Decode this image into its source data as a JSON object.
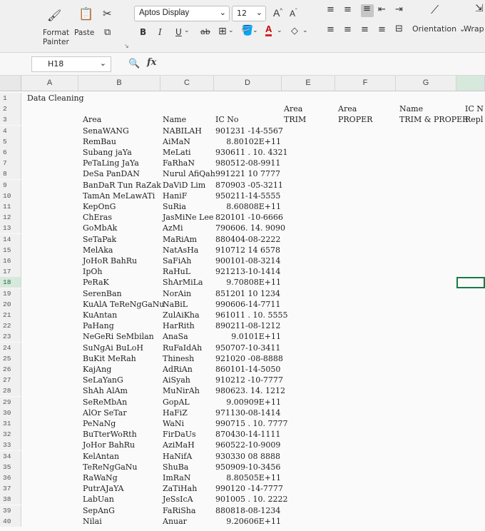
{
  "ribbon": {
    "format_painter": "Format\nPainter",
    "paste": "Paste",
    "font_name": "Aptos Display",
    "font_size": "12",
    "bold": "B",
    "italic": "I",
    "underline": "U",
    "strike": "ab",
    "grow": "A",
    "shrink": "A",
    "orientation": "Orientation",
    "wrap": "Wrap"
  },
  "formula_bar": {
    "name_box": "H18",
    "fx": "fx",
    "formula": ""
  },
  "columns": [
    "A",
    "B",
    "C",
    "D",
    "E",
    "F",
    "G"
  ],
  "rows": [
    {
      "n": "1",
      "a": "Data Cleaning"
    },
    {
      "n": "2",
      "e": "Area",
      "f": "Area",
      "g": "Name",
      "h": "IC N"
    },
    {
      "n": "3",
      "b": "Area",
      "c": "Name",
      "d": "IC No",
      "e": "TRIM",
      "f": "PROPER",
      "g": "TRIM & PROPER",
      "h": "Repl"
    },
    {
      "n": "4",
      "b": "SenaWANG",
      "c": "NABILAH",
      "d": "901231 -14-5567"
    },
    {
      "n": "5",
      "b": "RemBau",
      "c": "AiMaN",
      "dnum": "8.80102E+11"
    },
    {
      "n": "6",
      "b": "Subang jaYa",
      "c": "MeLati",
      "d": "930611 . 10. 4321"
    },
    {
      "n": "7",
      "b": "PeTaLing    JaYa",
      "c": "FaRhaN",
      "d": "980512-08-9911"
    },
    {
      "n": "8",
      "b": "DeSa PanDAN",
      "c": "Nurul AfiQah",
      "d": "991221 10 7777"
    },
    {
      "n": "9",
      "b": "BanDaR Tun RaZak",
      "c": "DaViD Lim",
      "d": "870903 -05-3211"
    },
    {
      "n": "10",
      "b": "TamAn  MeLawATi",
      "c": "HaniF",
      "d": "950211-14-5555"
    },
    {
      "n": "11",
      "b": "  KepOnG",
      "c": "SuRia",
      "dnum": "8.60808E+11"
    },
    {
      "n": "12",
      "b": "ChEras",
      "c": "JasMiNe Lee",
      "d": "820101 -10-6666"
    },
    {
      "n": "13",
      "b": "  GoMbAk",
      "c": "AzMi",
      "d": "790606. 14. 9090"
    },
    {
      "n": "14",
      "b": "SeTaPak",
      "c": "MaRiAm",
      "d": "880404-08-2222"
    },
    {
      "n": "15",
      "b": "MelAka",
      "c": "NatAsHa",
      "d": "910712 14 6578"
    },
    {
      "n": "16",
      "b": "JoHoR BahRu",
      "c": "SaFiAh",
      "d": "900101-08-3214"
    },
    {
      "n": "17",
      "b": "  IpOh",
      "c": "RaHuL",
      "d": "921213-10-1414"
    },
    {
      "n": "18",
      "b": "PeRaK",
      "c": "ShArMiLa",
      "dnum": "9.70808E+11"
    },
    {
      "n": "19",
      "b": "SerenBan",
      "c": "NorAin",
      "d": "851201 10 1234"
    },
    {
      "n": "20",
      "b": "KuAlA  TeReNgGaNu",
      "c": "NaBiL",
      "d": "990606-14-7711"
    },
    {
      "n": "21",
      "b": "KuAntan",
      "c": "ZulAiKha",
      "d": "961011 . 10. 5555"
    },
    {
      "n": "22",
      "b": "PaHang",
      "c": "HarRith",
      "d": "890211-08-1212"
    },
    {
      "n": "23",
      "b": "NeGeRi  SeMbilan",
      "c": "AnaSa",
      "dnum": "9.0101E+11"
    },
    {
      "n": "24",
      "b": "SuNgAi BuLoH",
      "c": "RuFaIdAh",
      "d": "950707-10-3411"
    },
    {
      "n": "25",
      "b": "BuKit MeRah",
      "c": "Thinesh",
      "d": "921020 -08-8888"
    },
    {
      "n": "26",
      "b": "KajAng",
      "c": "AdRiAn",
      "d": "860101-14-5050"
    },
    {
      "n": "27",
      "b": "SeLaYanG",
      "c": "AiSyah",
      "d": "910212 -10-7777"
    },
    {
      "n": "28",
      "b": "ShAh  AlAm",
      "c": "MuNirAh",
      "d": "980623. 14. 1212"
    },
    {
      "n": "29",
      "b": "SeReMbAn",
      "c": "GopAL",
      "dnum": "9.00909E+11"
    },
    {
      "n": "30",
      "b": "AlOr SeTar",
      "c": "HaFiZ",
      "d": "971130-08-1414"
    },
    {
      "n": "31",
      "b": "PeNaNg",
      "c": "WaNi",
      "d": "990715 . 10. 7777"
    },
    {
      "n": "32",
      "b": "BuTterWoRth",
      "c": "FirDaUs",
      "d": "870430-14-1111"
    },
    {
      "n": "33",
      "b": "JoHor BahRu",
      "c": "AziMaH",
      "d": "960522-10-9009"
    },
    {
      "n": "34",
      "b": "KelAntan",
      "c": "  HaNifA",
      "d": "930330 08 8888"
    },
    {
      "n": "35",
      "b": "TeReNgGaNu",
      "c": "ShuBa",
      "d": "950909-10-3456"
    },
    {
      "n": "36",
      "b": "RaWaNg",
      "c": "  ImRaN",
      "dnum": "8.80505E+11"
    },
    {
      "n": "37",
      "b": "PutrAJaYA",
      "c": "ZaTiHah",
      "d": "990120 -14-7777"
    },
    {
      "n": "38",
      "b": "LabUan",
      "c": "JeSsIcA",
      "d": "901005 . 10. 2222"
    },
    {
      "n": "39",
      "b": "SepAnG",
      "c": "FaRiSha",
      "d": "880818-08-1234"
    },
    {
      "n": "40",
      "b": "Nilai",
      "c": "Anuar",
      "dnum": "9.20606E+11"
    }
  ]
}
